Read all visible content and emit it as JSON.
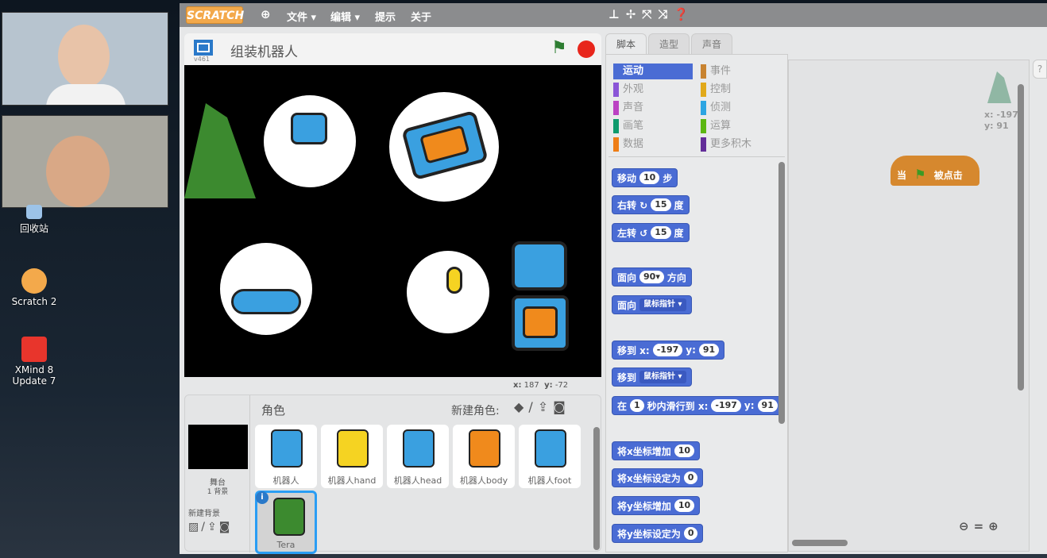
{
  "desktop": {
    "icons": [
      {
        "label": "回收站"
      },
      {
        "label": "Scratch 2"
      },
      {
        "label": "XMind 8\nUpdate 7"
      }
    ]
  },
  "menu": {
    "logo": "SCRATCH",
    "items": [
      "文件 ▾",
      "编辑 ▾",
      "提示",
      "关于"
    ],
    "tool_icons": [
      "stamp-icon",
      "grow-icon",
      "shrink-icon",
      "fullscreen-icon",
      "help-icon"
    ]
  },
  "stage": {
    "version": "v461",
    "title": "组装机器人",
    "mouse_x_label": "x:",
    "mouse_x": "187",
    "mouse_y_label": "y:",
    "mouse_y": "-72",
    "flag_color": "#2e7d32",
    "stop_color": "#e8261c"
  },
  "sprites_panel": {
    "header": "角色",
    "new_sprite_label": "新建角色:",
    "stage_label": "舞台",
    "stage_backdrops": "1 背景",
    "new_backdrop_label": "新建背景",
    "sprites": [
      {
        "name": "机器人"
      },
      {
        "name": "机器人hand"
      },
      {
        "name": "机器人head"
      },
      {
        "name": "机器人body"
      },
      {
        "name": "机器人foot"
      },
      {
        "name": "Tera",
        "selected": true
      }
    ]
  },
  "tabs": [
    {
      "label": "脚本",
      "active": true
    },
    {
      "label": "造型"
    },
    {
      "label": "声音"
    }
  ],
  "categories": [
    {
      "label": "运动",
      "color": "#4a6cd4",
      "active": true
    },
    {
      "label": "事件",
      "color": "#c88330"
    },
    {
      "label": "外观",
      "color": "#8a55d7"
    },
    {
      "label": "控制",
      "color": "#e1a91a"
    },
    {
      "label": "声音",
      "color": "#bb42c3"
    },
    {
      "label": "侦测",
      "color": "#2ca5e2"
    },
    {
      "label": "画笔",
      "color": "#0e9a6c"
    },
    {
      "label": "运算",
      "color": "#5cb712"
    },
    {
      "label": "数据",
      "color": "#ee7d16"
    },
    {
      "label": "更多积木",
      "color": "#632d99"
    }
  ],
  "blocks": [
    [
      {
        "t": "移动"
      },
      {
        "n": "10"
      },
      {
        "t": "步"
      }
    ],
    [
      {
        "t": "右转 ↻"
      },
      {
        "n": "15"
      },
      {
        "t": "度"
      }
    ],
    [
      {
        "t": "左转 ↺"
      },
      {
        "n": "15"
      },
      {
        "t": "度"
      }
    ],
    [
      {
        "t": "面向"
      },
      {
        "n": "90▾"
      },
      {
        "t": "方向"
      }
    ],
    [
      {
        "t": "面向"
      },
      {
        "d": "鼠标指针 ▾"
      }
    ],
    [
      {
        "t": "移到 x:"
      },
      {
        "n": "-197"
      },
      {
        "t": "y:"
      },
      {
        "n": "91"
      }
    ],
    [
      {
        "t": "移到"
      },
      {
        "d": "鼠标指针 ▾"
      }
    ],
    [
      {
        "t": "在"
      },
      {
        "n": "1"
      },
      {
        "t": "秒内滑行到 x:"
      },
      {
        "n": "-197"
      },
      {
        "t": "y:"
      },
      {
        "n": "91"
      }
    ],
    [
      {
        "t": "将x坐标增加"
      },
      {
        "n": "10"
      }
    ],
    [
      {
        "t": "将x坐标设定为"
      },
      {
        "n": "0"
      }
    ],
    [
      {
        "t": "将y坐标增加"
      },
      {
        "n": "10"
      }
    ],
    [
      {
        "t": "将y坐标设定为"
      },
      {
        "n": "0"
      }
    ]
  ],
  "script_area": {
    "sprite_x": "x: -197",
    "sprite_y": "y: 91",
    "hat_block": {
      "before": "当",
      "after": "被点击",
      "color": "#d6882e"
    },
    "zoom_controls": [
      "zoom-out-icon",
      "zoom-reset-icon",
      "zoom-in-icon"
    ]
  }
}
